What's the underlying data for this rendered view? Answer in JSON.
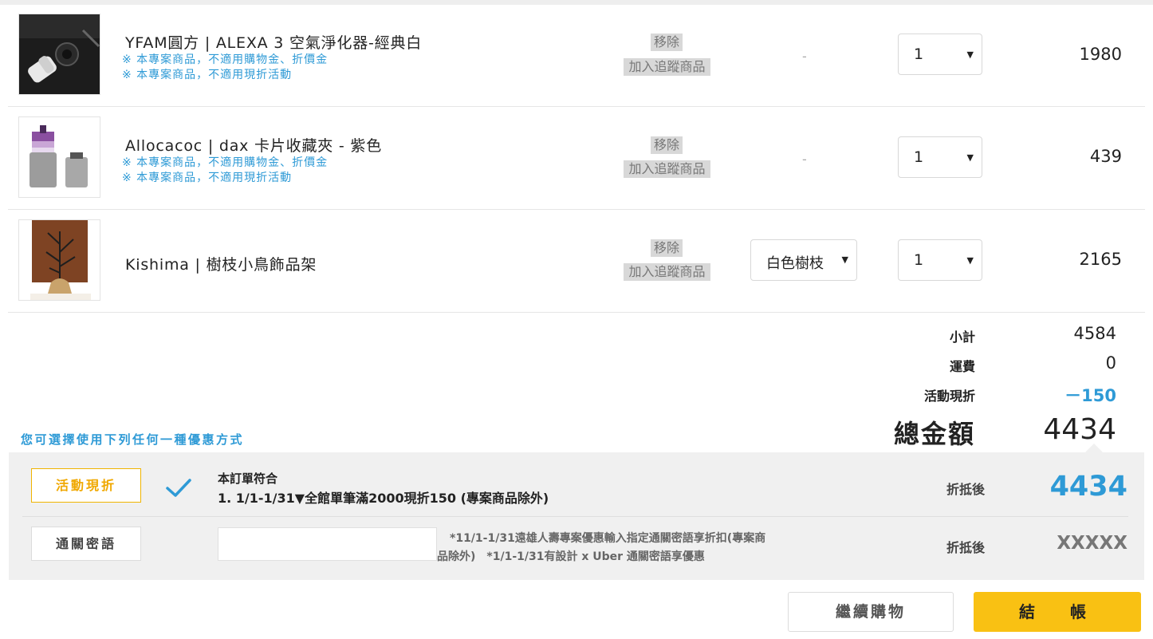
{
  "cart": {
    "items": [
      {
        "name": "YFAM圓方 | ALEXA 3 空氣淨化器-經典白",
        "notes": [
          "※ 本專案商品，不適用購物金、折價金",
          "※ 本專案商品，不適用現折活動"
        ],
        "remove_label": "移除",
        "track_label": "加入追蹤商品",
        "spec": "-",
        "qty": "1",
        "price": "1980"
      },
      {
        "name": "Allocacoc  | dax 卡片收藏夾 - 紫色",
        "notes": [
          "※ 本專案商品，不適用購物金、折價金",
          "※ 本專案商品，不適用現折活動"
        ],
        "remove_label": "移除",
        "track_label": "加入追蹤商品",
        "spec": "-",
        "qty": "1",
        "price": "439"
      },
      {
        "name": "Kishima | 樹枝小鳥飾品架",
        "notes": [],
        "remove_label": "移除",
        "track_label": "加入追蹤商品",
        "spec": "白色樹枝",
        "qty": "1",
        "price": "2165"
      }
    ]
  },
  "summary": {
    "subtotal_label": "小計",
    "subtotal_value": "4584",
    "shipping_label": "運費",
    "shipping_value": "0",
    "discount_label": "活動現折",
    "discount_value": "－150",
    "total_label": "總金額",
    "total_value": "4434"
  },
  "promo": {
    "heading": "您可選擇使用下列任何一種優惠方式",
    "activity_button": "活動現折",
    "activity_line1": "本訂單符合",
    "activity_line2": "1. 1/1-1/31▼全館單筆滿2000現折150 (專案商品除外)",
    "activity_after_label": "折抵後",
    "activity_after_value": "4434",
    "pass_button": "通關密語",
    "pass_input_value": "",
    "pass_note_line1": "*11/1-1/31遠雄人壽專案優惠輸入指定通關密語享折扣(專案商",
    "pass_note_line2": "品除外)　*1/1-1/31有設計 x Uber 通關密語享優惠",
    "pass_after_label": "折抵後",
    "pass_after_value": "XXXXX"
  },
  "actions": {
    "continue_label": "繼續購物",
    "checkout_label": "結　帳"
  },
  "colors": {
    "accent_blue": "#2e9ad6",
    "accent_yellow": "#f9c113",
    "panel_gray": "#f0f0f0"
  }
}
